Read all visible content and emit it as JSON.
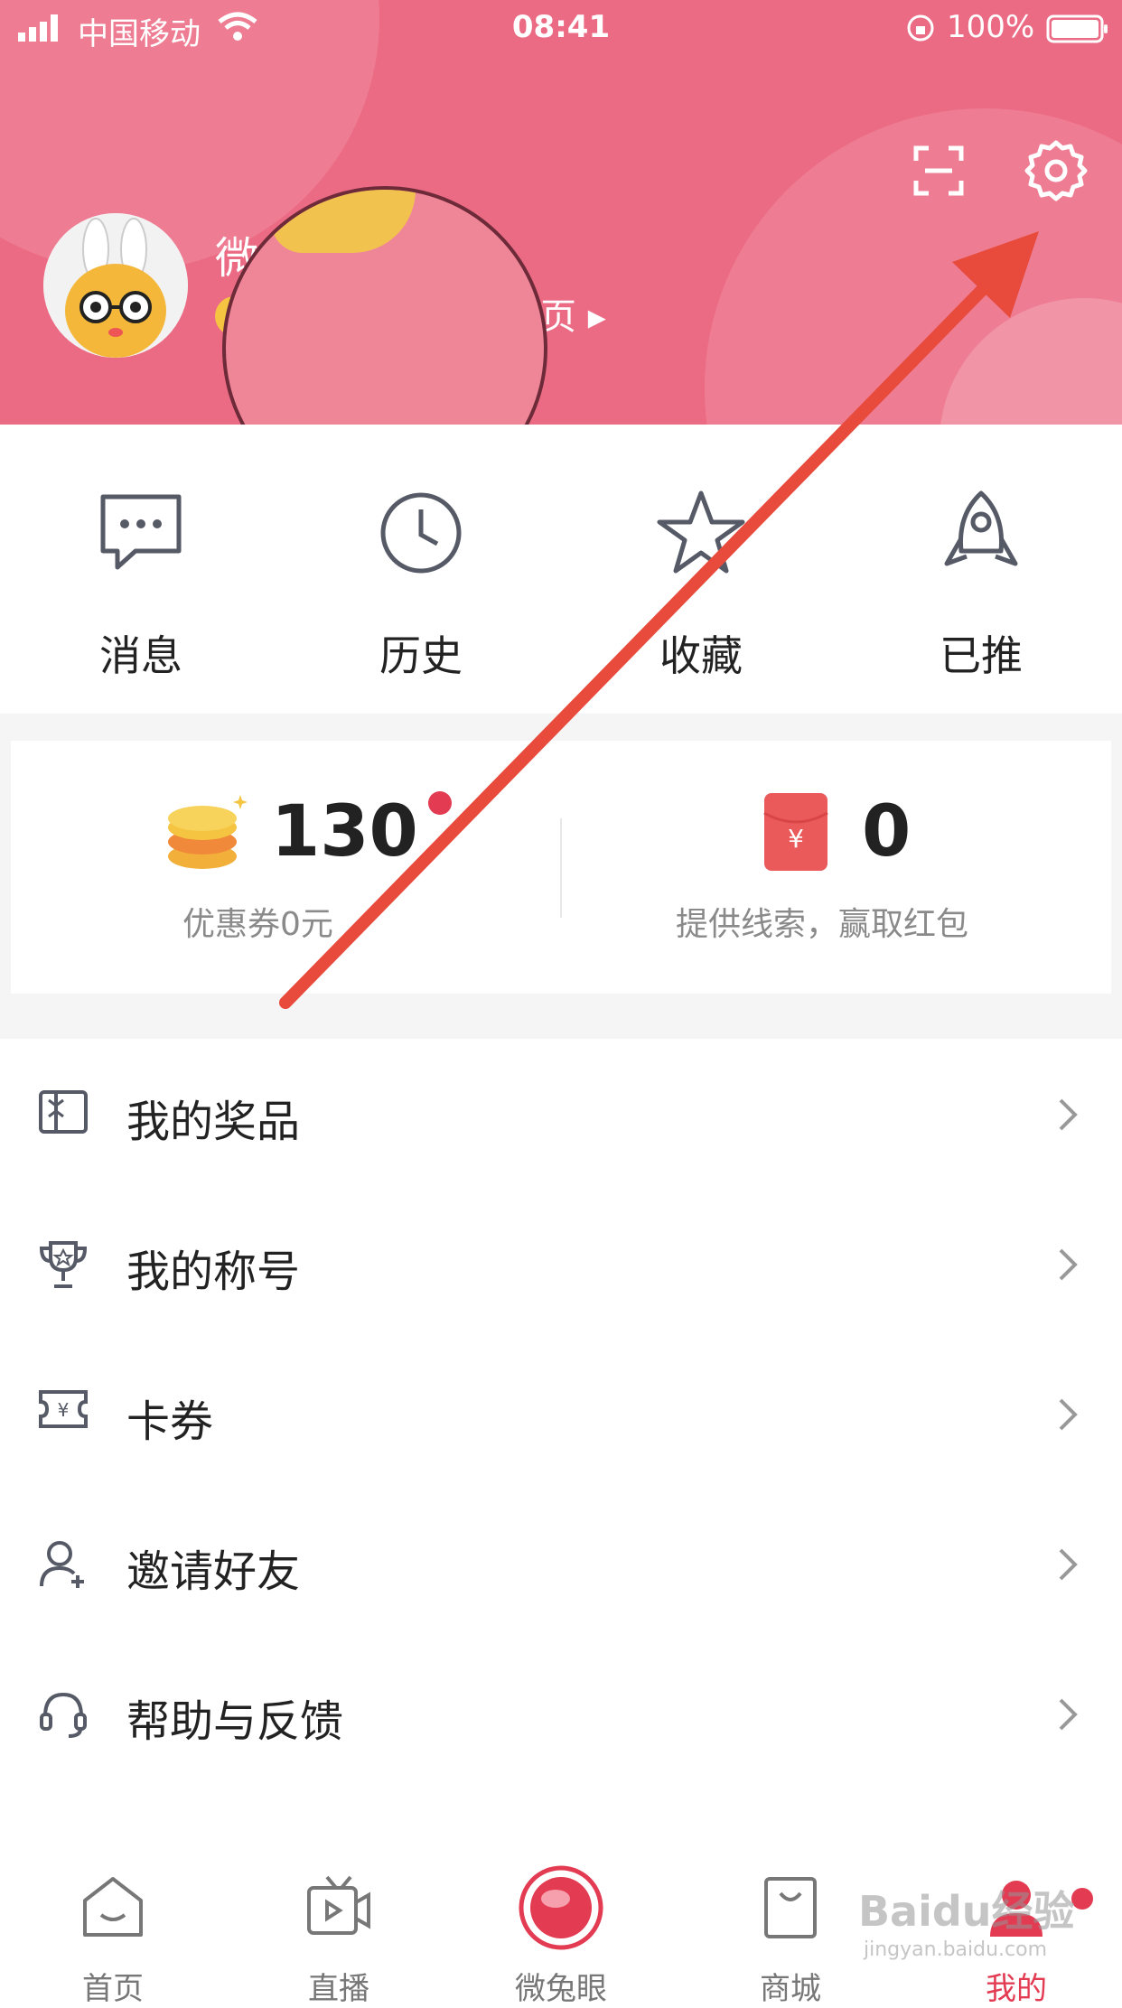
{
  "status_bar": {
    "carrier": "中国移动",
    "time": "08:41",
    "battery": "100%"
  },
  "profile": {
    "username_fragment": "微",
    "homepage_link": "页 ▸"
  },
  "quick_actions": [
    {
      "label": "消息",
      "icon": "message-icon"
    },
    {
      "label": "历史",
      "icon": "clock-icon"
    },
    {
      "label": "收藏",
      "icon": "star-icon"
    },
    {
      "label": "已推",
      "icon": "rocket-icon"
    }
  ],
  "wallet": {
    "coins": "130",
    "coupon_text": "优惠券0元",
    "coupon_tail": "",
    "red_packet_count": "0",
    "red_packet_text": "提供线索，赢取红包"
  },
  "menu": [
    {
      "label": "我的奖品",
      "icon": "gift-icon"
    },
    {
      "label": "我的称号",
      "icon": "trophy-icon"
    },
    {
      "label": "卡券",
      "icon": "ticket-icon"
    },
    {
      "label": "邀请好友",
      "icon": "add-user-icon"
    },
    {
      "label": "帮助与反馈",
      "icon": "headset-icon"
    }
  ],
  "tabbar": [
    {
      "label": "首页",
      "icon": "home-icon"
    },
    {
      "label": "直播",
      "icon": "tv-icon"
    },
    {
      "label": "微兔眼",
      "icon": "eye-icon"
    },
    {
      "label": "商城",
      "icon": "shopping-bag-icon"
    },
    {
      "label": "我的",
      "icon": "user-icon",
      "active": true
    }
  ],
  "watermark": {
    "brand": "Baidu经验",
    "url": "jingyan.baidu.com"
  },
  "colors": {
    "header": "#ec6b84",
    "accent_red": "#e23b52",
    "annotation_arrow": "#e84a3c"
  }
}
